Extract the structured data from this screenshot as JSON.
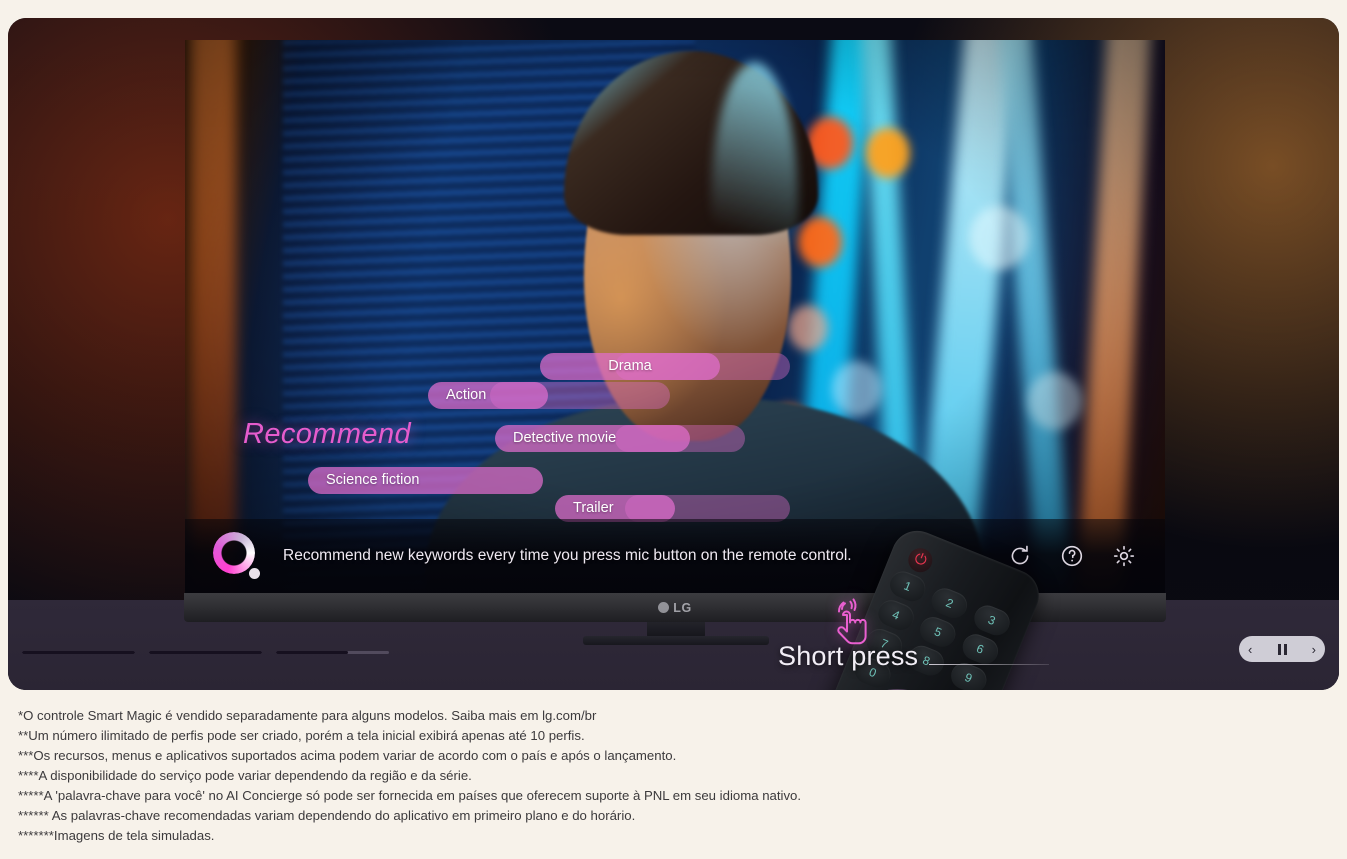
{
  "tv_ui": {
    "recommend_label": "Recommend",
    "keywords": [
      {
        "label": "Drama"
      },
      {
        "label": "Action"
      },
      {
        "label": "Detective movie"
      },
      {
        "label": "Science fiction"
      },
      {
        "label": "Trailer"
      }
    ],
    "status_text": "Recommend new keywords every time you press mic button on the remote control.",
    "status_icons": [
      {
        "name": "refresh-icon"
      },
      {
        "name": "help-icon"
      },
      {
        "name": "settings-gear-icon"
      }
    ],
    "brand": "LG"
  },
  "remote": {
    "power_label": "⏻",
    "keys": [
      "1",
      "2",
      "3",
      "4",
      "5",
      "6",
      "7",
      "8",
      "9",
      "0"
    ],
    "mic_label": "🎙",
    "dir_labels": {
      "up": "↑",
      "right": "→",
      "down": "↓",
      "left": "←"
    }
  },
  "callout": {
    "label": "Short press",
    "icon": "hand-tap-icon"
  },
  "carousel": {
    "prev_label": "‹",
    "next_label": "›",
    "state": "paused"
  },
  "progress": {
    "bars": [
      {
        "fill_percent": 100
      },
      {
        "fill_percent": 100
      },
      {
        "fill_percent": 64
      }
    ]
  },
  "footnotes": [
    "*O controle Smart Magic é vendido separadamente para alguns modelos. Saiba mais em lg.com/br",
    "**Um número ilimitado de perfis pode ser criado, porém a tela inicial exibirá apenas até 10 perfis.",
    "***Os recursos, menus e aplicativos suportados acima podem variar de acordo com o país e após o lançamento.",
    "****A disponibilidade do serviço pode variar dependendo da região e da série.",
    "*****A 'palavra-chave para você' no AI Concierge só pode ser fornecida em países que oferecem suporte à PNL em seu idioma nativo.",
    "****** As palavras-chave recomendadas variam dependendo do aplicativo em primeiro plano e do horário.",
    "*******Imagens de tela simuladas."
  ],
  "colors": {
    "page_bg": "#f7f2ea",
    "hero_bg": "#0a0a12",
    "accent_magenta": "#e65ccd",
    "pill_bg": "#e06ecd",
    "bottom_strip": "#2f2939",
    "carousel_bg": "#cfcdd6"
  }
}
